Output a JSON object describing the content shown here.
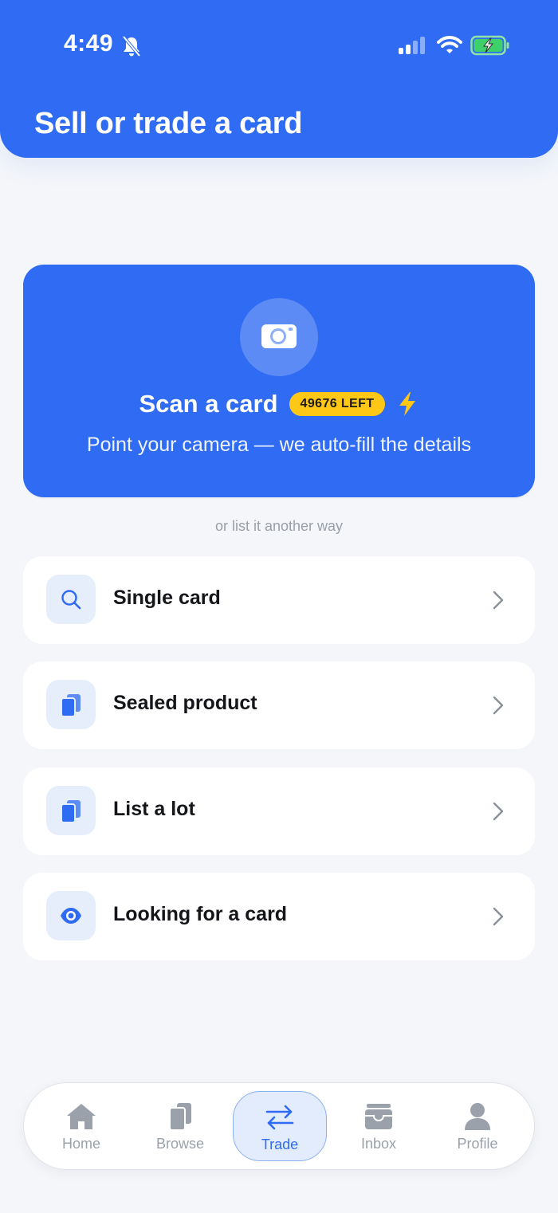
{
  "status_bar": {
    "time": "4:49"
  },
  "header": {
    "title": "Sell or trade a card"
  },
  "scan": {
    "title": "Scan a card",
    "badge": "49676 LEFT",
    "subtitle": "Point your camera — we auto-fill the details"
  },
  "divider_text": "or list it another way",
  "options": [
    {
      "label": "Single card",
      "icon": "search-icon"
    },
    {
      "label": "Sealed product",
      "icon": "cards-icon"
    },
    {
      "label": "List a lot",
      "icon": "cards-icon"
    },
    {
      "label": "Looking for a card",
      "icon": "eye-icon"
    }
  ],
  "nav": {
    "items": [
      {
        "label": "Home",
        "icon": "home-icon"
      },
      {
        "label": "Browse",
        "icon": "cards-icon"
      },
      {
        "label": "Trade",
        "icon": "swap-arrows-icon",
        "active": true
      },
      {
        "label": "Inbox",
        "icon": "inbox-icon"
      },
      {
        "label": "Profile",
        "icon": "person-icon"
      }
    ]
  },
  "colors": {
    "primary": "#2f6bf3",
    "badge": "#ffc817",
    "bolt": "#ffc817",
    "icon_bg": "#e6eefc",
    "inactive": "#9ba1aa",
    "background": "#f4f6f9"
  }
}
